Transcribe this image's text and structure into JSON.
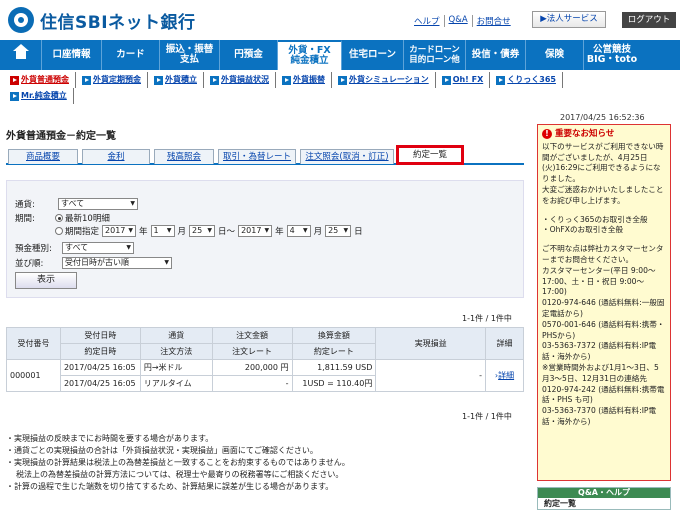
{
  "header": {
    "logo_text": "住信SBIネット銀行",
    "links": [
      "ヘルプ",
      "Q&A",
      "お問合せ"
    ],
    "corp_button": "▶法人サービス",
    "logout_button": "ログアウト"
  },
  "nav": {
    "items": [
      "口座情報",
      "カード",
      "振込・振替\n支払",
      "円預金",
      "外貨・FX\n純金積立",
      "住宅ローン",
      "カードローン\n目的ローン他",
      "投信・債券",
      "保険",
      "公営競技\nBIG・toto"
    ]
  },
  "subnav": {
    "row1": [
      "外貨普通預金",
      "外貨定期預金",
      "外貨積立",
      "外貨損益状況",
      "外貨振替",
      "外貨シミュレーション",
      "Oh! FX",
      "くりっく365"
    ],
    "row2": [
      "Mr.純金積立"
    ]
  },
  "timestamp": "2017/04/25 16:52:36",
  "page_title": "外貨普通預金－約定一覧",
  "tabs": [
    "商品概要",
    "金利",
    "残高照会",
    "取引・為替レート",
    "注文照会(取消・訂正)",
    "約定一覧"
  ],
  "form": {
    "currency_label": "通貨:",
    "currency_value": "すべて",
    "period_label": "期間:",
    "period_option1": "最新10明細",
    "period_option2": "期間指定",
    "from_year": "2017",
    "from_month": "1",
    "from_day": "25",
    "to_year": "2017",
    "to_month": "4",
    "to_day": "25",
    "unit_year": "年",
    "unit_month": "月",
    "unit_day": "日",
    "unit_day_range": "日～",
    "deposit_label": "預金種別:",
    "deposit_value": "すべて",
    "sort_label": "並び順:",
    "sort_value": "受付日時が古い順",
    "show_button": "表示"
  },
  "count_top": "1-1件 / 1件中",
  "count_bottom": "1-1件 / 1件中",
  "table": {
    "headers": {
      "receipt_no": "受付番号",
      "received_at": "受付日時",
      "executed_at": "約定日時",
      "currency": "通貨",
      "order_method": "注文方法",
      "order_amount": "注文金額",
      "order_rate": "注文レート",
      "converted_amount": "換算金額",
      "exec_rate": "約定レート",
      "pnl": "実現損益",
      "detail": "詳細"
    },
    "row": {
      "receipt_no": "000001",
      "received_at": "2017/04/25 16:05",
      "executed_at": "2017/04/25 16:05",
      "currency": "円→米ドル",
      "order_method": "リアルタイム",
      "order_amount": "200,000 円",
      "order_rate": "-",
      "converted_amount": "1,811.59 USD",
      "exec_rate": "1USD = 110.40円",
      "pnl": "-",
      "detail": "詳細"
    }
  },
  "notes": [
    "・実現損益の反映までにお時間を要する場合があります。",
    "・通貨ごとの実現損益の合計は「外貨損益状況・実現損益」画面にてご確認ください。",
    "・実現損益の計算結果は税法上の為替差損益と一致することをお約束するものではありません。",
    "税法上の為替差損益の計算方法については、税理士や最寄りの税務署等にご相談ください。",
    "・計算の過程で生じた端数を切り捨てするため、計算結果に誤差が生じる場合があります。"
  ],
  "notice": {
    "title": "重要なお知らせ",
    "lines": [
      "以下のサービスがご利用できない時間がございましたが、4月25日(火)16:29にご利用できるようになりました。",
      "大変ご迷惑おかけいたしましたことをお詫び申し上げます。",
      "・くりっく365のお取引き全般",
      "・OhFXのお取引き全般",
      "ご不明な点は弊社カスタマーセンターまでお問合せください。",
      "カスタマーセンター(平日 9:00～17:00、土・日・祝日 9:00～17:00)",
      "0120-974-646 (通話料無料:一般固定電話から)",
      "0570-001-646 (通話料有料:携帯・PHSから)",
      "03-5363-7372 (通話料有料:IP電話・海外から)",
      "※営業時間外および1月1～3日、5月3～5日、12月31日の連絡先",
      "0120-974-242 (通話料無料:携帯電話・PHS も可)",
      "03-5363-7370 (通話料有料:IP電話・海外から)"
    ]
  },
  "qa": {
    "header": "Q&A・ヘルプ",
    "item": "約定一覧"
  },
  "colors": {
    "brand_blue": "#0b72c0",
    "alert_red": "#e00010",
    "notice_bg": "#fffbd0"
  }
}
